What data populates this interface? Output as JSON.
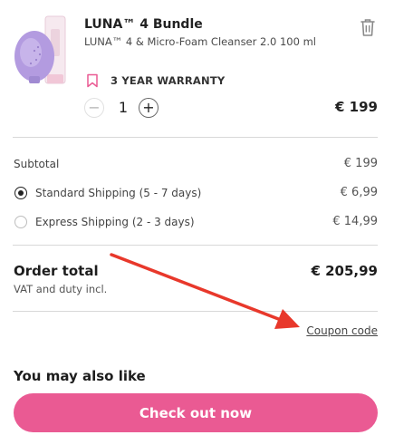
{
  "product": {
    "name": "LUNA™ 4 Bundle",
    "description": "LUNA™ 4 & Micro-Foam Cleanser 2.0 100 ml",
    "warranty": "3 YEAR WARRANTY",
    "quantity": "1",
    "price": "€ 199",
    "qty_minus": "−",
    "qty_plus": "+"
  },
  "summary": {
    "subtotal_label": "Subtotal",
    "subtotal_value": "€ 199",
    "shipping_options": [
      {
        "label": "Standard Shipping (5 - 7 days)",
        "value": "€ 6,99",
        "selected": true
      },
      {
        "label": "Express Shipping (2 - 3 days)",
        "value": "€ 14,99",
        "selected": false
      }
    ],
    "order_total_label": "Order total",
    "order_total_value": "€ 205,99",
    "vat_note": "VAT and duty incl.",
    "coupon_link": "Coupon code"
  },
  "recommendations": {
    "heading": "You may also like"
  },
  "checkout": {
    "button_label": "Check out now"
  },
  "colors": {
    "accent": "#ea5a93",
    "annotation_arrow": "#e8382b",
    "device": "#b39be0"
  },
  "icons": {
    "delete": "trash-icon",
    "warranty": "bookmark-icon"
  }
}
